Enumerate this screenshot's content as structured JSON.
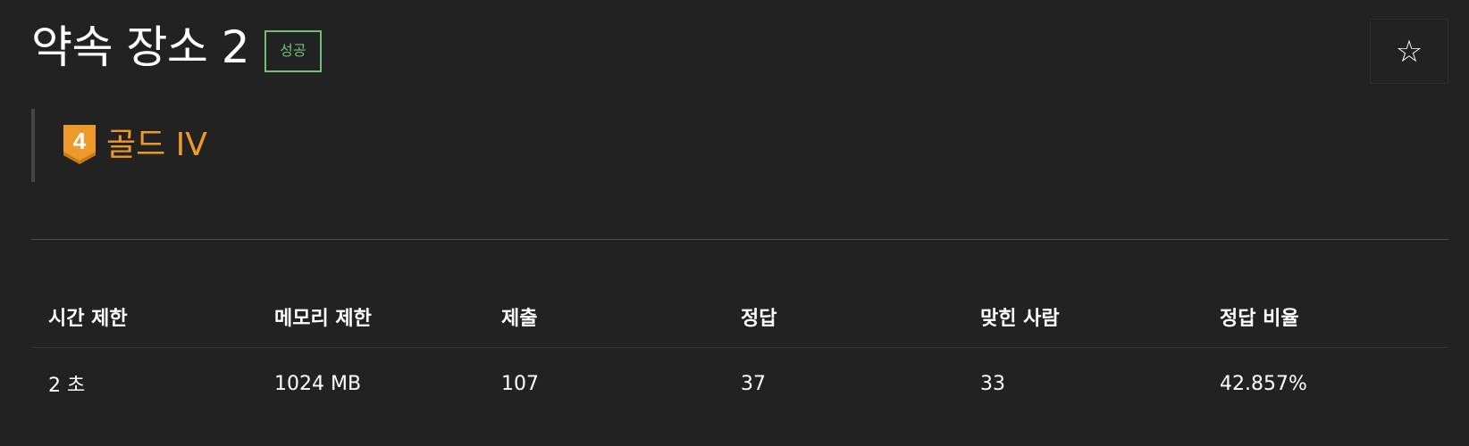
{
  "problem": {
    "title": "약속 장소 2",
    "status_badge": "성공",
    "star_icon": "star-outline-icon",
    "star_glyph": "☆"
  },
  "tier": {
    "number": "4",
    "label": "골드 IV",
    "icon": "gold-tier-badge-icon",
    "color": "#ec9a29"
  },
  "info_table": {
    "headers": [
      "시간 제한",
      "메모리 제한",
      "제출",
      "정답",
      "맞힌 사람",
      "정답 비율"
    ],
    "values": [
      "2 초",
      "1024 MB",
      "107",
      "37",
      "33",
      "42.857%"
    ]
  },
  "colors": {
    "background": "#222222",
    "success": "#6fc276",
    "gold": "#ec9a29",
    "text": "#ffffff"
  }
}
